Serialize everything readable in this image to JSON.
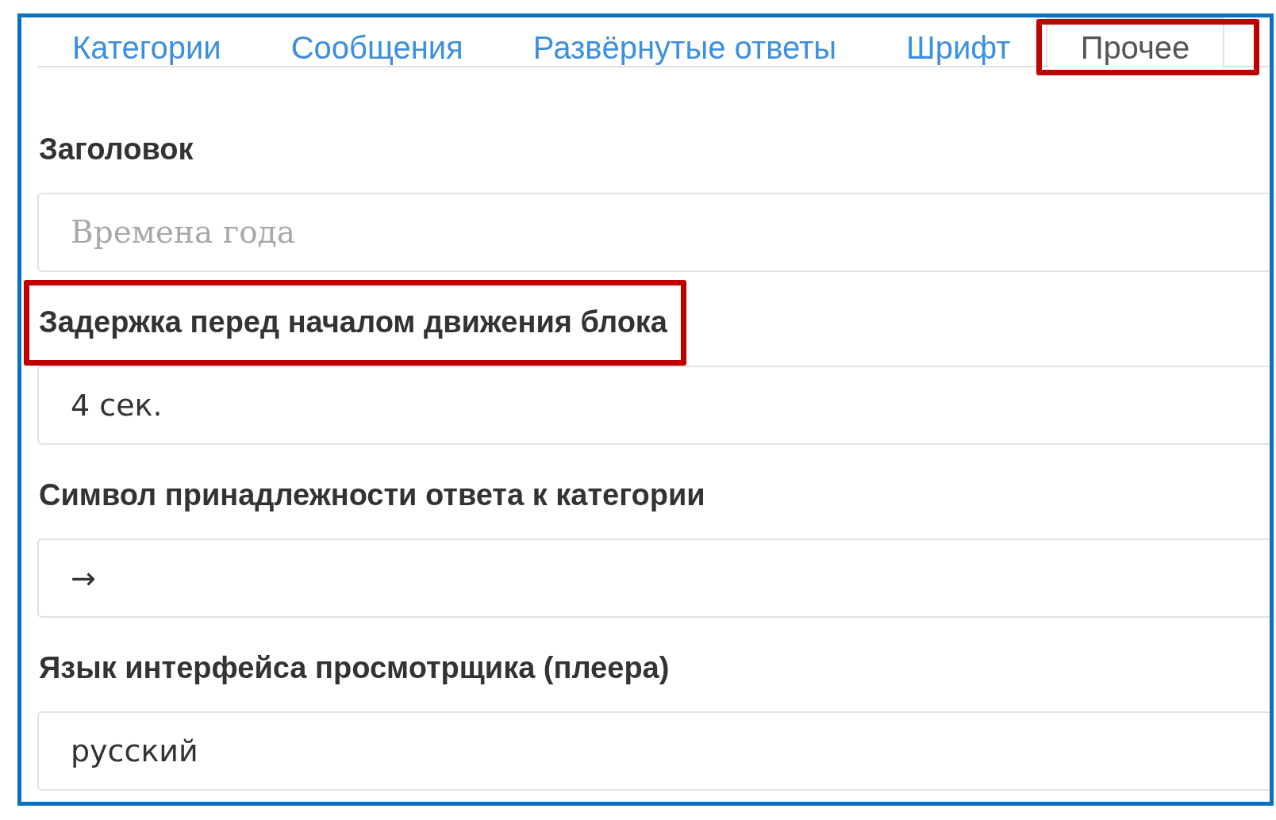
{
  "tabs": [
    {
      "label": "Категории",
      "selected": false,
      "highlighted": false
    },
    {
      "label": "Сообщения",
      "selected": false,
      "highlighted": false
    },
    {
      "label": "Развёрнутые ответы",
      "selected": false,
      "highlighted": false
    },
    {
      "label": "Шрифт",
      "selected": false,
      "highlighted": false
    },
    {
      "label": "Прочее",
      "selected": true,
      "highlighted": true
    }
  ],
  "fields": [
    {
      "label": "Заголовок",
      "placeholder": "Времена года",
      "highlighted": false
    },
    {
      "label": "Задержка перед началом движения блока",
      "value": "4 сек.",
      "highlighted": true
    },
    {
      "label": "Символ принадлежности ответа к категории",
      "value": "→",
      "highlighted": false
    },
    {
      "label": "Язык интерфейса просмотрщика (плеера)",
      "value": "русский",
      "highlighted": false
    }
  ]
}
